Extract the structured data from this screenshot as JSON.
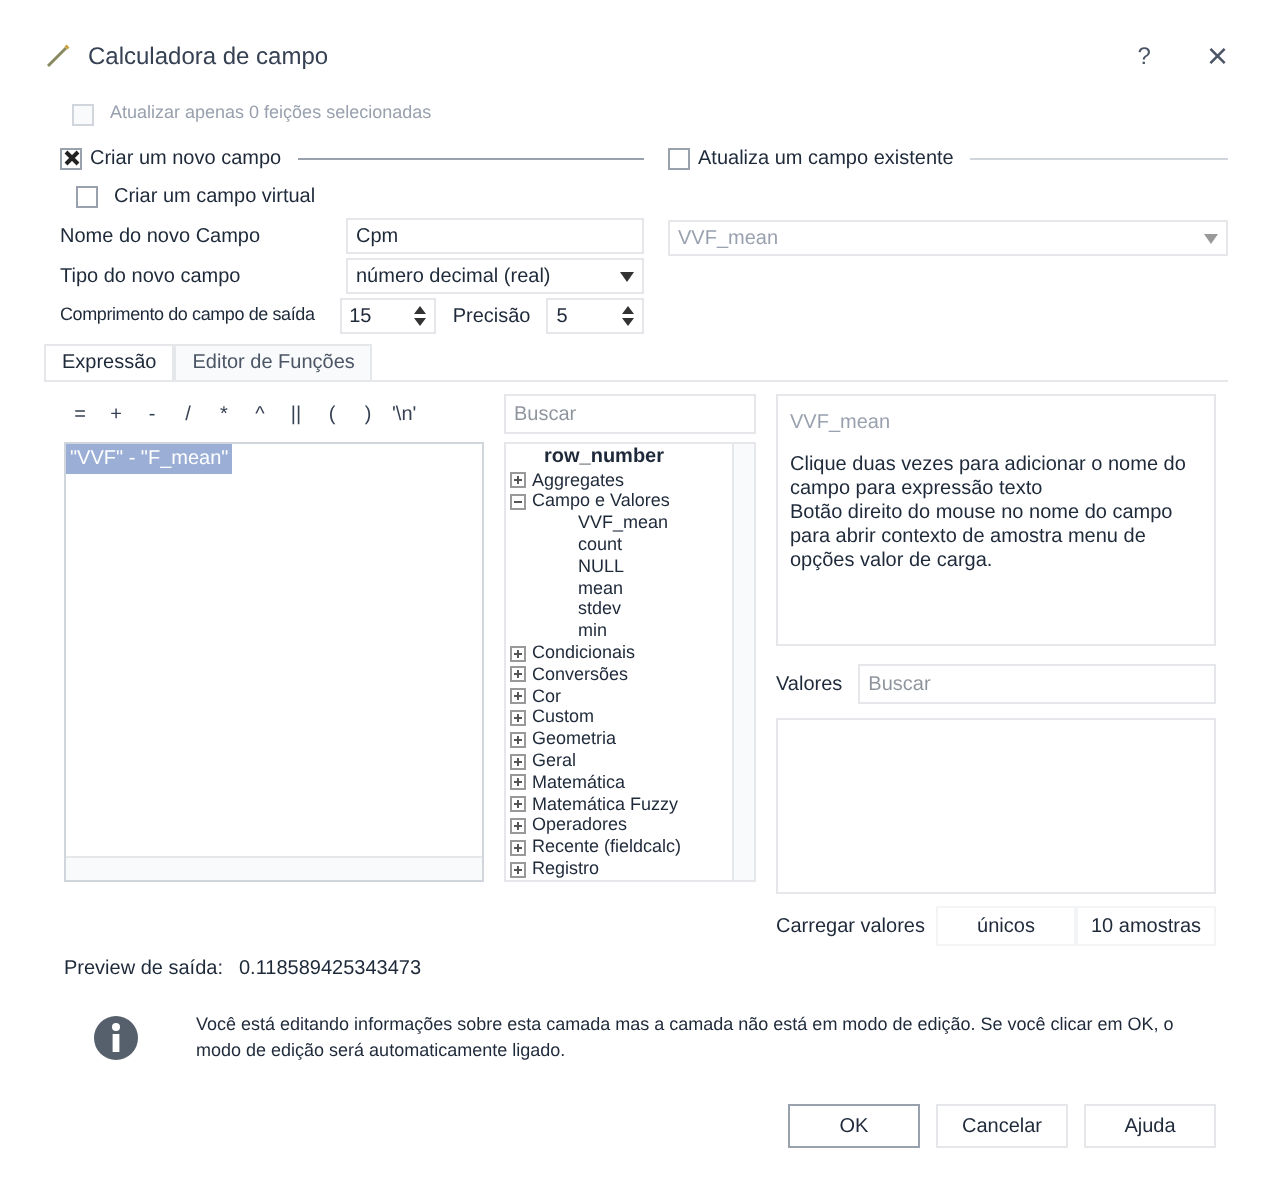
{
  "window": {
    "title": "Calculadora de campo",
    "help": "?",
    "close": "×"
  },
  "only_selected": {
    "label": "Atualizar apenas 0 feições selecionadas",
    "checked": false,
    "disabled": true
  },
  "create_group": {
    "label": "Criar um novo campo",
    "checked": true
  },
  "virtual": {
    "label": "Criar um campo virtual",
    "checked": false
  },
  "fields": [
    {
      "label": "Nome do novo Campo",
      "kind": "text",
      "value": "Cpm"
    },
    {
      "label": "Tipo do novo campo",
      "kind": "combo",
      "value": "número decimal (real)"
    }
  ],
  "length": {
    "label": "Comprimento do campo de saída",
    "value": "15",
    "precision_label": "Precisão",
    "precision": "5"
  },
  "update_group": {
    "label": "Atualiza um campo existente",
    "checked": false,
    "field": "VVF_mean"
  },
  "tabs": [
    {
      "label": "Expressão",
      "selected": true
    },
    {
      "label": "Editor de Funções",
      "selected": false
    }
  ],
  "operators": [
    "=",
    "+",
    "-",
    "/",
    "*",
    "^",
    "||",
    "(",
    ")",
    "'\\n'"
  ],
  "expression": "\"VVF\" - \"F_mean\"",
  "search": {
    "placeholder": "Buscar"
  },
  "tree": [
    {
      "label": "row_number",
      "bold": true
    },
    {
      "label": "Aggregates",
      "expanded": false
    },
    {
      "label": "Campo e Valores",
      "expanded": true,
      "children": [
        {
          "label": "VVF_mean"
        },
        {
          "label": "count"
        },
        {
          "label": "NULL"
        },
        {
          "label": "mean"
        },
        {
          "label": "stdev"
        },
        {
          "label": "min"
        }
      ]
    },
    {
      "label": "Condicionais",
      "expanded": false
    },
    {
      "label": "Conversões",
      "expanded": false
    },
    {
      "label": "Cor",
      "expanded": false
    },
    {
      "label": "Custom",
      "expanded": false
    },
    {
      "label": "Geometria",
      "expanded": false
    },
    {
      "label": "Geral",
      "expanded": false
    },
    {
      "label": "Matemática",
      "expanded": false
    },
    {
      "label": "Matemática Fuzzy",
      "expanded": false
    },
    {
      "label": "Operadores",
      "expanded": false
    },
    {
      "label": "Recente (fieldcalc)",
      "expanded": false
    },
    {
      "label": "Registro",
      "expanded": false
    }
  ],
  "help_panel": {
    "title": "VVF_mean",
    "text": "Clique duas vezes para adicionar o nome do campo para expressão texto\nBotão direito do mouse no nome do campo para abrir contexto de amostra menu de opções valor de carga."
  },
  "values": {
    "label": "Valores",
    "placeholder": "Buscar",
    "load_label": "Carregar valores",
    "buttons": [
      "únicos",
      "10 amostras"
    ]
  },
  "preview": {
    "label": "Preview de saída:",
    "value": "0.118589425343473"
  },
  "info": "Você está editando informações sobre esta camada mas a camada não está em modo de edição. Se você clicar em OK, o modo de edição será automaticamente ligado.",
  "buttons": [
    "OK",
    "Cancelar",
    "Ajuda"
  ]
}
